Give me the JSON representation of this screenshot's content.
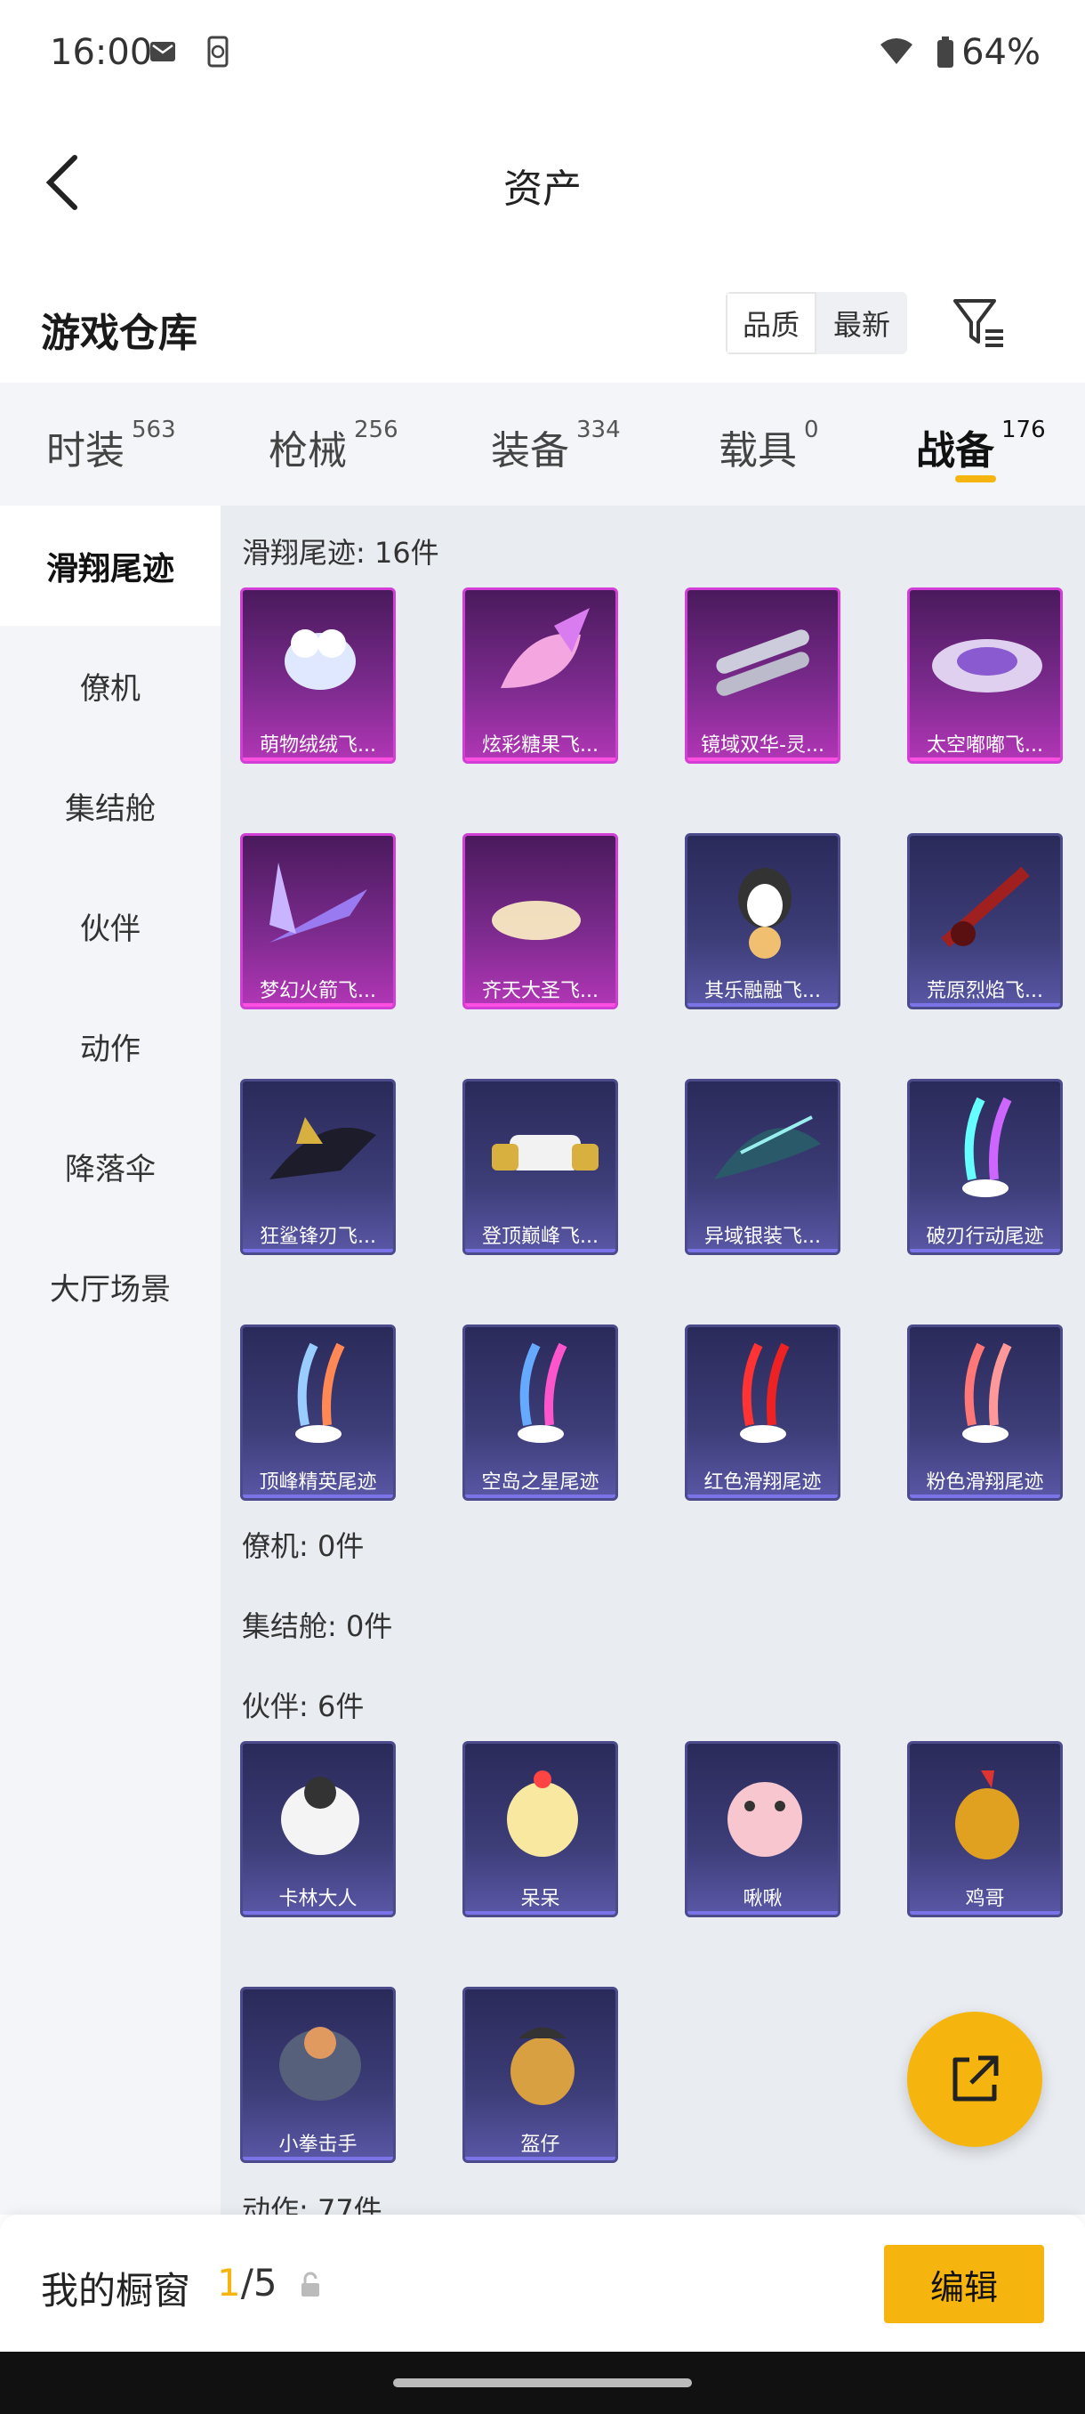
{
  "status_bar": {
    "time": "16:00",
    "battery": "64%"
  },
  "header": {
    "title": "资产"
  },
  "warehouse": {
    "title": "游戏仓库",
    "sort_quality": "品质",
    "sort_newest": "最新"
  },
  "tabs": [
    {
      "label": "时装",
      "count": "563"
    },
    {
      "label": "枪械",
      "count": "256"
    },
    {
      "label": "装备",
      "count": "334"
    },
    {
      "label": "载具",
      "count": "0"
    },
    {
      "label": "战备",
      "count": "176"
    }
  ],
  "sidebar": [
    "滑翔尾迹",
    "僚机",
    "集结舱",
    "伙伴",
    "动作",
    "降落伞",
    "大厅场景"
  ],
  "sections": {
    "glide": "滑翔尾迹: 16件",
    "wingman": "僚机: 0件",
    "rally": "集结舱: 0件",
    "partner": "伙伴: 6件",
    "action": "动作: 77件"
  },
  "glide_items": [
    {
      "name": "萌物绒绒飞...",
      "quality": "pink"
    },
    {
      "name": "炫彩糖果飞...",
      "quality": "pink"
    },
    {
      "name": "镜域双华-灵...",
      "quality": "pink"
    },
    {
      "name": "太空嘟嘟飞...",
      "quality": "pink"
    },
    {
      "name": "梦幻火箭飞...",
      "quality": "pink"
    },
    {
      "name": "齐天大圣飞...",
      "quality": "pink"
    },
    {
      "name": "其乐融融飞...",
      "quality": "blue"
    },
    {
      "name": "荒原烈焰飞...",
      "quality": "blue"
    },
    {
      "name": "狂鲨锋刃飞...",
      "quality": "blue"
    },
    {
      "name": "登顶巅峰飞...",
      "quality": "blue"
    },
    {
      "name": "异域银装飞...",
      "quality": "blue"
    },
    {
      "name": "破刃行动尾迹",
      "quality": "blue"
    },
    {
      "name": "顶峰精英尾迹",
      "quality": "blue"
    },
    {
      "name": "空岛之星尾迹",
      "quality": "blue"
    },
    {
      "name": "红色滑翔尾迹",
      "quality": "blue"
    },
    {
      "name": "粉色滑翔尾迹",
      "quality": "blue"
    }
  ],
  "partner_items": [
    {
      "name": "卡林大人",
      "quality": "blue"
    },
    {
      "name": "呆呆",
      "quality": "blue"
    },
    {
      "name": "啾啾",
      "quality": "blue"
    },
    {
      "name": "鸡哥",
      "quality": "blue"
    },
    {
      "name": "小拳击手",
      "quality": "blue"
    },
    {
      "name": "盔仔",
      "quality": "blue"
    }
  ],
  "bottom_bar": {
    "title": "我的橱窗",
    "current": "1",
    "total": "/5",
    "edit_label": "编辑"
  },
  "colors": {
    "accent": "#f5b50e",
    "pink_quality": "#d13fd6",
    "blue_quality": "#4b4b8c"
  }
}
